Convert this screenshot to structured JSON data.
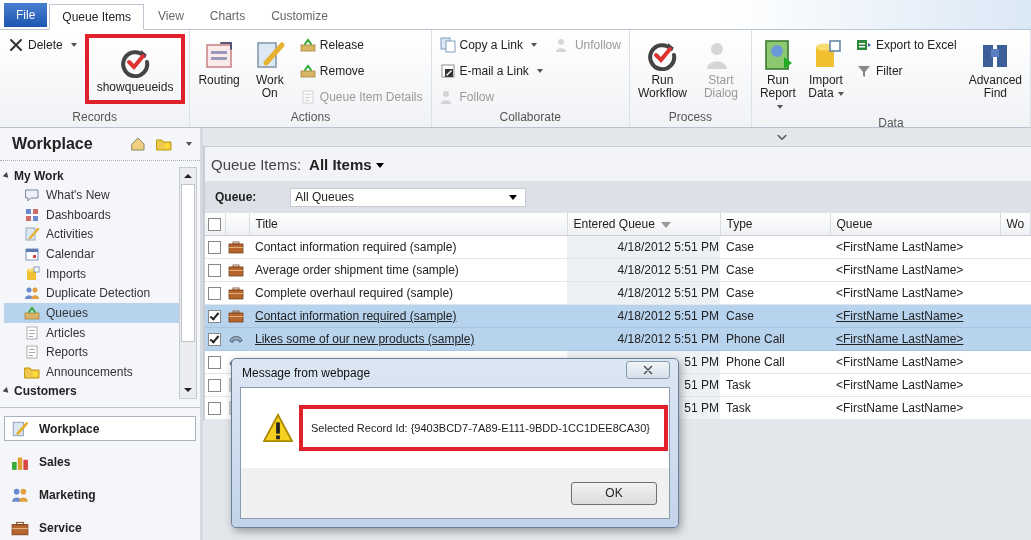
{
  "tabs": [
    {
      "label": "File",
      "kind": "file",
      "selected": false
    },
    {
      "label": "Queue Items",
      "kind": "tab",
      "selected": true
    },
    {
      "label": "View",
      "kind": "tab",
      "selected": false
    },
    {
      "label": "Charts",
      "kind": "tab",
      "selected": false
    },
    {
      "label": "Customize",
      "kind": "tab",
      "selected": false
    }
  ],
  "ribbon": {
    "groups": [
      {
        "label": "Records",
        "columns": [
          [
            {
              "label": "Delete",
              "kind": "small",
              "disabled": false,
              "dropdown": true
            }
          ],
          [
            {
              "label": "showqueueids",
              "kind": "large",
              "disabled": false,
              "dropdown": false,
              "highlighted": true
            }
          ]
        ]
      },
      {
        "label": "Actions",
        "columns": [
          [
            {
              "label": "Routing",
              "kind": "large",
              "disabled": false,
              "dropdown": false
            }
          ],
          [
            {
              "label": "Work On",
              "kind": "large",
              "disabled": false,
              "dropdown": false
            }
          ],
          [
            {
              "label": "Release",
              "kind": "small",
              "disabled": false,
              "dropdown": false
            },
            {
              "label": "Remove",
              "kind": "small",
              "disabled": false,
              "dropdown": false
            },
            {
              "label": "Queue Item Details",
              "kind": "small",
              "disabled": true,
              "dropdown": false
            }
          ]
        ]
      },
      {
        "label": "Collaborate",
        "columns": [
          [
            {
              "label": "Copy a Link",
              "kind": "small",
              "disabled": false,
              "dropdown": true
            },
            {
              "label": "E-mail a Link",
              "kind": "small",
              "disabled": false,
              "dropdown": true
            },
            {
              "label": "Follow",
              "kind": "small",
              "disabled": true,
              "dropdown": false
            }
          ],
          [
            {
              "label": "Unfollow",
              "kind": "small",
              "disabled": true,
              "dropdown": false
            }
          ]
        ]
      },
      {
        "label": "Process",
        "columns": [
          [
            {
              "label": "Run Workflow",
              "kind": "large",
              "disabled": false,
              "dropdown": false
            }
          ],
          [
            {
              "label": "Start Dialog",
              "kind": "large",
              "disabled": true,
              "dropdown": false
            }
          ]
        ]
      },
      {
        "label": "Data",
        "columns": [
          [
            {
              "label": "Run Report",
              "kind": "large",
              "disabled": false,
              "dropdown": true
            }
          ],
          [
            {
              "label": "Import Data",
              "kind": "large",
              "disabled": false,
              "dropdown": true
            }
          ],
          [
            {
              "label": "Export to Excel",
              "kind": "small",
              "disabled": false,
              "dropdown": false
            },
            {
              "label": "Filter",
              "kind": "small",
              "disabled": false,
              "dropdown": false
            }
          ],
          [
            {
              "label": "Advanced Find",
              "kind": "large",
              "disabled": false,
              "dropdown": false
            }
          ]
        ]
      }
    ]
  },
  "sidebar": {
    "title": "Workplace",
    "sections": [
      {
        "label": "My Work",
        "expanded": true,
        "items": [
          {
            "label": "What's New",
            "selected": false
          },
          {
            "label": "Dashboards",
            "selected": false
          },
          {
            "label": "Activities",
            "selected": false
          },
          {
            "label": "Calendar",
            "selected": false
          },
          {
            "label": "Imports",
            "selected": false
          },
          {
            "label": "Duplicate Detection",
            "selected": false
          },
          {
            "label": "Queues",
            "selected": true
          },
          {
            "label": "Articles",
            "selected": false
          },
          {
            "label": "Reports",
            "selected": false
          },
          {
            "label": "Announcements",
            "selected": false
          }
        ]
      },
      {
        "label": "Customers",
        "expanded": true
      }
    ],
    "nav": [
      {
        "label": "Workplace",
        "selected": true
      },
      {
        "label": "Sales",
        "selected": false
      },
      {
        "label": "Marketing",
        "selected": false
      },
      {
        "label": "Service",
        "selected": false
      }
    ]
  },
  "view": {
    "label": "Queue Items:",
    "name": "All Items"
  },
  "filter": {
    "label": "Queue:",
    "value": "All Queues"
  },
  "table": {
    "select_all": {
      "checked": false
    },
    "columns": [
      {
        "label": "Title",
        "sorted": false
      },
      {
        "label": "Entered Queue",
        "sorted": true
      },
      {
        "label": "Type",
        "sorted": false
      },
      {
        "label": "Queue",
        "sorted": false
      },
      {
        "label": "Wo"
      }
    ],
    "rows": [
      {
        "checked": false,
        "selected": false,
        "title": "Contact information required (sample)",
        "entered": "4/18/2012 5:51 PM",
        "type": "Case",
        "queue": "<FirstName LastName>"
      },
      {
        "checked": false,
        "selected": false,
        "title": "Average order shipment time (sample)",
        "entered": "4/18/2012 5:51 PM",
        "type": "Case",
        "queue": "<FirstName LastName>"
      },
      {
        "checked": false,
        "selected": false,
        "title": "Complete overhaul required (sample)",
        "entered": "4/18/2012 5:51 PM",
        "type": "Case",
        "queue": "<FirstName LastName>"
      },
      {
        "checked": true,
        "selected": true,
        "title": "Contact information required (sample)",
        "entered": "4/18/2012 5:51 PM",
        "type": "Case",
        "queue": "<FirstName LastName>"
      },
      {
        "checked": true,
        "selected": true,
        "title": "Likes some of our new products (sample)",
        "entered": "4/18/2012 5:51 PM",
        "type": "Phone Call",
        "queue": "<FirstName LastName>"
      },
      {
        "checked": false,
        "selected": false,
        "entered": "51 PM",
        "type": "Phone Call",
        "queue": "<FirstName LastName>"
      },
      {
        "checked": false,
        "selected": false,
        "entered": "51 PM",
        "type": "Task",
        "queue": "<FirstName LastName>"
      },
      {
        "checked": false,
        "selected": false,
        "entered": "51 PM",
        "type": "Task",
        "queue": "<FirstName LastName>"
      }
    ]
  },
  "dialog": {
    "title": "Message from webpage",
    "message": "Selected Record Id: {9403BCD7-7A89-E111-9BDD-1CC1DEE8CA30}",
    "highlighted": true,
    "button": "OK"
  }
}
